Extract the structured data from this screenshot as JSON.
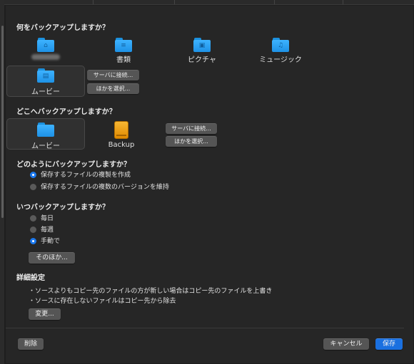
{
  "sections": {
    "source_heading": "何をバックアップしますか？",
    "dest_heading": "どこへバックアップしますか？",
    "method_heading": "どのようにバックアップしますか？",
    "schedule_heading": "いつバックアップしますか？",
    "details_heading": "詳細設定"
  },
  "source_items": [
    {
      "label": "",
      "icon": "home-folder-icon",
      "glyph": "⌂"
    },
    {
      "label": "書類",
      "icon": "documents-folder-icon",
      "glyph": "≡"
    },
    {
      "label": "ピクチャ",
      "icon": "pictures-folder-icon",
      "glyph": "▣"
    },
    {
      "label": "ミュージック",
      "icon": "music-folder-icon",
      "glyph": "♫"
    },
    {
      "label": "ムービー",
      "icon": "movies-folder-icon",
      "glyph": "▤"
    }
  ],
  "source_buttons": {
    "connect": "サーバに接続...",
    "choose": "ほかを選択..."
  },
  "dest_items": [
    {
      "label": "ムービー",
      "icon": "folder-icon",
      "glyph": ""
    },
    {
      "label": "Backup",
      "icon": "external-drive-icon"
    }
  ],
  "dest_buttons": {
    "connect": "サーバに接続...",
    "choose": "ほかを選択..."
  },
  "method_options": [
    {
      "label": "保存するファイルの複製を作成",
      "selected": true
    },
    {
      "label": "保存するファイルの複数のバージョンを維持",
      "selected": false
    }
  ],
  "schedule_options": [
    {
      "label": "毎日",
      "selected": false
    },
    {
      "label": "毎週",
      "selected": false
    },
    {
      "label": "手動で",
      "selected": true
    }
  ],
  "schedule_more_button": "そのほか...",
  "details_lines": [
    "・ソースよりもコピー先のファイルの方が新しい場合はコピー先のファイルを上書き",
    "・ソースに存在しないファイルはコピー先から除去"
  ],
  "details_change_button": "変更...",
  "footer": {
    "delete": "削除",
    "cancel": "キャンセル",
    "save": "保存"
  },
  "colors": {
    "accent": "#1a70e0",
    "folder": "#3db2ff",
    "drive": "#f7b733"
  }
}
